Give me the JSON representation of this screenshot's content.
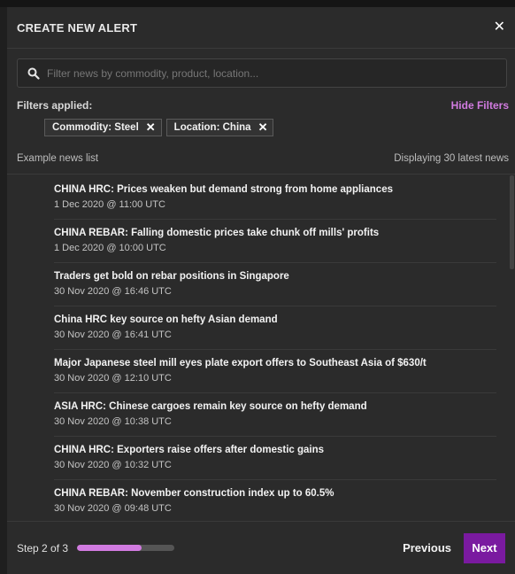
{
  "modal": {
    "title": "CREATE NEW ALERT",
    "close_glyph": "✕"
  },
  "search": {
    "placeholder": "Filter news by commodity, product, location...",
    "value": ""
  },
  "filters": {
    "label": "Filters applied:",
    "hide_label": "Hide Filters",
    "chips": [
      {
        "label": "Commodity: Steel",
        "remove_glyph": "✕"
      },
      {
        "label": "Location: China",
        "remove_glyph": "✕"
      }
    ]
  },
  "list_header": {
    "left": "Example news list",
    "right": "Displaying 30 latest news"
  },
  "news": [
    {
      "title": "CHINA HRC: Prices weaken but demand strong from home appliances",
      "date": "1 Dec 2020 @ 11:00 UTC"
    },
    {
      "title": "CHINA REBAR: Falling domestic prices take chunk off mills' profits",
      "date": "1 Dec 2020 @ 10:00 UTC"
    },
    {
      "title": "Traders get bold on rebar positions in Singapore",
      "date": "30 Nov 2020 @ 16:46 UTC"
    },
    {
      "title": "China HRC key source on hefty Asian demand",
      "date": "30 Nov 2020 @ 16:41 UTC"
    },
    {
      "title": "Major Japanese steel mill eyes plate export offers to Southeast Asia of $630/t",
      "date": "30 Nov 2020 @ 12:10 UTC"
    },
    {
      "title": "ASIA HRC: Chinese cargoes remain key source on hefty demand",
      "date": "30 Nov 2020 @ 10:38 UTC"
    },
    {
      "title": "CHINA HRC: Exporters raise offers after domestic gains",
      "date": "30 Nov 2020 @ 10:32 UTC"
    },
    {
      "title": "CHINA REBAR: November construction index up to 60.5%",
      "date": "30 Nov 2020 @ 09:48 UTC"
    }
  ],
  "footer": {
    "step_label": "Step 2 of 3",
    "progress_fraction": 0.66,
    "previous_label": "Previous",
    "next_label": "Next"
  },
  "colors": {
    "accent": "#d17be0",
    "primary_button": "#7a1aa0"
  },
  "icons": {
    "search": "search-icon",
    "close": "close-icon",
    "chip_remove": "close-icon"
  }
}
